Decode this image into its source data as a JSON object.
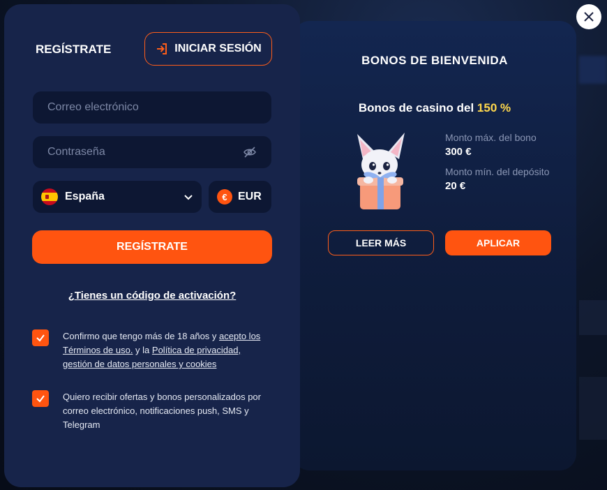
{
  "register": {
    "title": "REGÍSTRATE",
    "login_label": "INICIAR SESIÓN",
    "email_placeholder": "Correo electrónico",
    "password_placeholder": "Contraseña",
    "country": "España",
    "currency": "EUR",
    "currency_symbol": "€",
    "submit_label": "REGÍSTRATE",
    "activation_link": "¿Tienes un código de activación?",
    "terms": {
      "checked": true,
      "text_1": "Confirmo que tengo más de 18 años y ",
      "link_1": "acepto los Términos de uso.",
      "text_2": " y la ",
      "link_2": "Política de privacidad, gestión de datos personales y cookies"
    },
    "marketing": {
      "checked": true,
      "text": "Quiero recibir ofertas y bonos personalizados por correo electrónico, notificaciones push, SMS y Telegram"
    }
  },
  "bonus": {
    "title": "BONOS DE BIENVENIDA",
    "subtitle_prefix": "Bonos de casino del ",
    "subtitle_highlight": "150 %",
    "max_bonus_label": "Monto máx. del bono",
    "max_bonus_value": "300 €",
    "min_deposit_label": "Monto mín. del depósito",
    "min_deposit_value": "20 €",
    "read_more_label": "LEER MÁS",
    "apply_label": "APLICAR"
  },
  "colors": {
    "accent": "#ff5410",
    "highlight": "#ffd84d",
    "panel": "#17244a",
    "field": "#0d1733"
  }
}
